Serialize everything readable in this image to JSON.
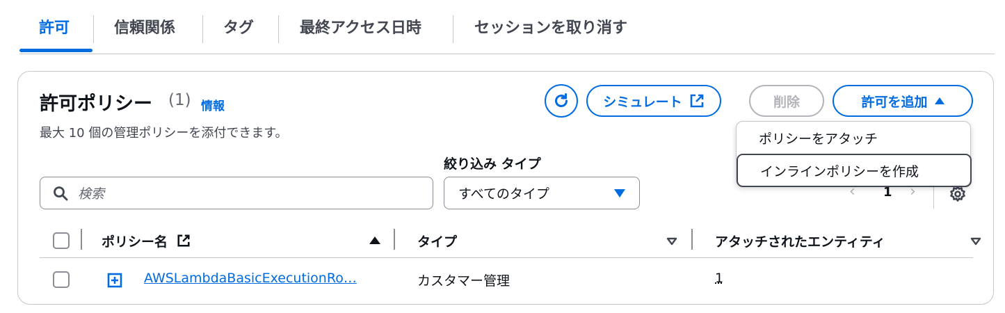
{
  "tabs": [
    {
      "label": "許可",
      "active": true
    },
    {
      "label": "信頼関係",
      "active": false
    },
    {
      "label": "タグ",
      "active": false
    },
    {
      "label": "最終アクセス日時",
      "active": false
    },
    {
      "label": "セッションを取り消す",
      "active": false
    }
  ],
  "panel": {
    "title": "許可ポリシー",
    "count": "(1)",
    "info_link": "情報",
    "description": "最大 10 個の管理ポリシーを添付できます。"
  },
  "actions": {
    "refresh_icon": "refresh-icon",
    "simulate_label": "シミュレート",
    "delete_label": "削除",
    "add_label": "許可を追加"
  },
  "filter": {
    "type_label": "絞り込み タイプ",
    "search_placeholder": "検索",
    "type_selected": "すべてのタイプ"
  },
  "pagination": {
    "current_page": "1"
  },
  "table": {
    "headers": [
      "ポリシー名",
      "タイプ",
      "アタッチされたエンティティ"
    ],
    "rows": [
      {
        "name": "AWSLambdaBasicExecutionRo…",
        "type": "カスタマー管理",
        "attached": "1"
      }
    ]
  },
  "menu": {
    "items": [
      "ポリシーをアタッチ",
      "インラインポリシーを作成"
    ]
  },
  "colors": {
    "accent": "#006ce0",
    "disabled": "#b4b4bb",
    "text": "#0f141a"
  }
}
